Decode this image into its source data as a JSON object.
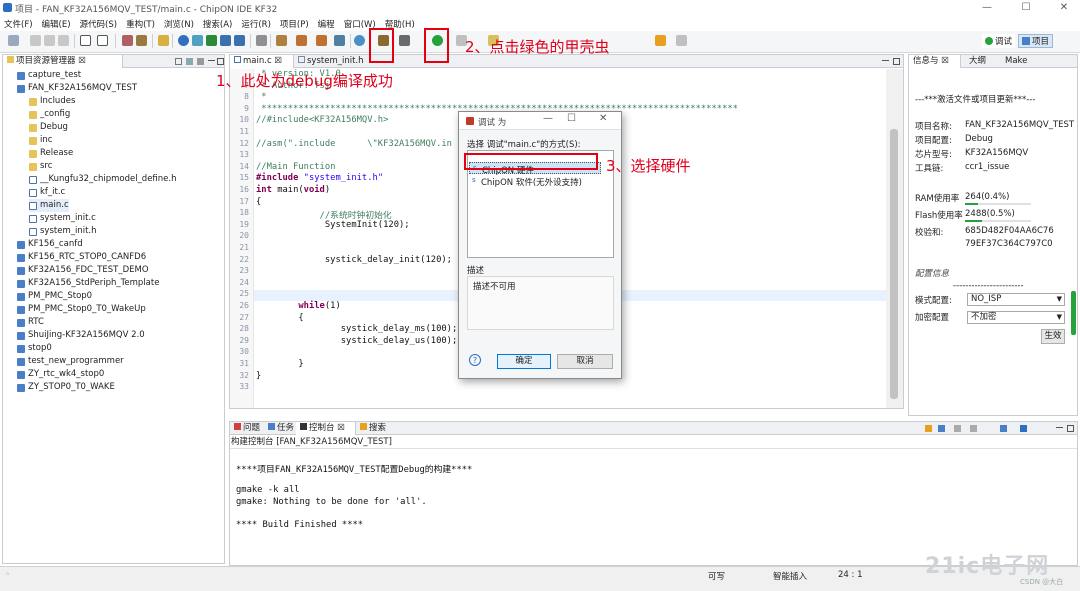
{
  "window": {
    "title": "项目 - FAN_KF32A156MQV_TEST/main.c - ChipON IDE KF32",
    "minimize": "—",
    "maximize": "☐",
    "close": "✕"
  },
  "menu": [
    "文件(F)",
    "编辑(E)",
    "源代码(S)",
    "重构(T)",
    "浏览(N)",
    "搜索(A)",
    "运行(R)",
    "项目(P)",
    "编程",
    "窗口(W)",
    "帮助(H)"
  ],
  "perspectives": {
    "debug": "调试",
    "project": "项目"
  },
  "project_explorer": {
    "title": "项目资源管理器 ☒",
    "items": [
      {
        "label": "capture_test",
        "type": "project",
        "level": 0
      },
      {
        "label": "FAN_KF32A156MQV_TEST",
        "type": "project",
        "level": 0
      },
      {
        "label": "Includes",
        "type": "folder",
        "level": 1
      },
      {
        "label": "_config",
        "type": "folder",
        "level": 1
      },
      {
        "label": "Debug",
        "type": "folder",
        "level": 1
      },
      {
        "label": "inc",
        "type": "folder",
        "level": 1
      },
      {
        "label": "Release",
        "type": "folder",
        "level": 1
      },
      {
        "label": "src",
        "type": "folder",
        "level": 1
      },
      {
        "label": "__Kungfu32_chipmodel_define.h",
        "type": "file",
        "level": 1
      },
      {
        "label": "kf_it.c",
        "type": "file",
        "level": 1
      },
      {
        "label": "main.c",
        "type": "file",
        "level": 1,
        "selected": true
      },
      {
        "label": "system_init.c",
        "type": "file",
        "level": 1
      },
      {
        "label": "system_init.h",
        "type": "file",
        "level": 1
      },
      {
        "label": "KF156_canfd",
        "type": "project",
        "level": 0
      },
      {
        "label": "KF156_RTC_STOP0_CANFD6",
        "type": "project",
        "level": 0
      },
      {
        "label": "KF32A156_FDC_TEST_DEMO",
        "type": "project",
        "level": 0
      },
      {
        "label": "KF32A156_StdPeriph_Template",
        "type": "project",
        "level": 0
      },
      {
        "label": "PM_PMC_Stop0",
        "type": "project",
        "level": 0
      },
      {
        "label": "PM_PMC_Stop0_T0_WakeUp",
        "type": "project",
        "level": 0
      },
      {
        "label": "RTC",
        "type": "project",
        "level": 0
      },
      {
        "label": "ShuiJing-KF32A156MQV 2.0",
        "type": "project",
        "level": 0
      },
      {
        "label": "stop0",
        "type": "project",
        "level": 0
      },
      {
        "label": "test_new_programmer",
        "type": "project",
        "level": 0
      },
      {
        "label": "ZY_rtc_wk4_stop0",
        "type": "project",
        "level": 0
      },
      {
        "label": "ZY_STOP0_T0_WAKE",
        "type": "project",
        "level": 0
      }
    ]
  },
  "editor": {
    "tabs": [
      "main.c ☒",
      "system_init.h"
    ],
    "lines": [
      {
        "n": "",
        "segs": [
          {
            "c": "cmt",
            "t": " * version: V1.0"
          }
        ]
      },
      {
        "n": "7",
        "segs": [
          {
            "c": "cmt",
            "t": " * Author: fsj"
          }
        ]
      },
      {
        "n": "8",
        "segs": [
          {
            "c": "cmt",
            "t": " *"
          }
        ]
      },
      {
        "n": "9",
        "segs": [
          {
            "c": "cmt",
            "t": " ******************************************************************************************"
          }
        ]
      },
      {
        "n": "10",
        "segs": [
          {
            "c": "cmt",
            "t": "//#include<KF32A156MQV.h>"
          }
        ]
      },
      {
        "n": "11",
        "segs": []
      },
      {
        "n": "12",
        "segs": [
          {
            "c": "cmt",
            "t": "//asm(\".include      \\\"KF32A156MQV.in"
          }
        ]
      },
      {
        "n": "13",
        "segs": []
      },
      {
        "n": "14",
        "segs": [
          {
            "c": "cmt",
            "t": "//Main Function"
          }
        ]
      },
      {
        "n": "15",
        "segs": [
          {
            "c": "kw",
            "t": "#include "
          },
          {
            "c": "str",
            "t": "\"system_init.h\""
          }
        ]
      },
      {
        "n": "16",
        "segs": [
          {
            "c": "kw",
            "t": "int "
          },
          {
            "c": "plain",
            "t": "main("
          },
          {
            "c": "kw",
            "t": "void"
          },
          {
            "c": "plain",
            "t": ")"
          }
        ]
      },
      {
        "n": "17",
        "segs": [
          {
            "c": "plain",
            "t": "{"
          }
        ]
      },
      {
        "n": "18",
        "segs": [
          {
            "c": "cmt",
            "t": "            //系统时钟初始化"
          }
        ]
      },
      {
        "n": "19",
        "segs": [
          {
            "c": "plain",
            "t": "             SystemInit(120);"
          }
        ]
      },
      {
        "n": "20",
        "segs": []
      },
      {
        "n": "21",
        "segs": []
      },
      {
        "n": "22",
        "segs": [
          {
            "c": "plain",
            "t": "             systick_delay_init(120);"
          }
        ]
      },
      {
        "n": "23",
        "segs": []
      },
      {
        "n": "24",
        "segs": []
      },
      {
        "n": "25",
        "segs": []
      },
      {
        "n": "26",
        "segs": [
          {
            "c": "kw",
            "t": "        while"
          },
          {
            "c": "plain",
            "t": "(1)"
          }
        ]
      },
      {
        "n": "27",
        "segs": [
          {
            "c": "plain",
            "t": "        {"
          }
        ]
      },
      {
        "n": "28",
        "segs": [
          {
            "c": "plain",
            "t": "                systick_delay_ms(100);"
          }
        ]
      },
      {
        "n": "29",
        "segs": [
          {
            "c": "plain",
            "t": "                systick_delay_us(100);"
          }
        ]
      },
      {
        "n": "30",
        "segs": []
      },
      {
        "n": "31",
        "segs": [
          {
            "c": "plain",
            "t": "        }"
          }
        ]
      },
      {
        "n": "32",
        "segs": [
          {
            "c": "plain",
            "t": "}"
          }
        ]
      },
      {
        "n": "33",
        "segs": []
      }
    ]
  },
  "dialog": {
    "title": "调试 为",
    "prompt": "选择 调试\"main.c\"的方式(S):",
    "options": [
      "ChipON 硬件",
      "ChipON 软件(无外设支持)"
    ],
    "desc_label": "描述",
    "desc_text": "描述不可用",
    "help": "?",
    "ok": "确定",
    "cancel": "取消"
  },
  "info_panel": {
    "tabs": [
      "信息与 ☒",
      "大纲",
      "Make"
    ],
    "notice": "---***激活文件或项目更新***---",
    "rows": [
      {
        "label": "项目名称:",
        "value": "FAN_KF32A156MQV_TEST"
      },
      {
        "label": "项目配置:",
        "value": "Debug"
      },
      {
        "label": "芯片型号:",
        "value": "KF32A156MQV"
      },
      {
        "label": "工具链:",
        "value": "ccr1_issue"
      }
    ],
    "ram_label": "RAM使用率",
    "ram_value": "264(0.4%)",
    "ram_fraction": 0.004,
    "flash_label": "Flash使用率",
    "flash_value": "2488(0.5%)",
    "flash_fraction": 0.005,
    "checksum_label": "校验和:",
    "checksum_1": "685D482F04AA6C76",
    "checksum_2": "79EF37C364C797C0",
    "config_title": "配置信息",
    "config_sep": "-----------------------",
    "mode_label": "模式配置:",
    "mode_value": "NO_ISP",
    "encrypt_label": "加密配置",
    "encrypt_value": "不加密",
    "apply": "生效"
  },
  "bottom": {
    "tabs": [
      "问题",
      "任务",
      "控制台 ☒",
      "搜索"
    ],
    "console_title": "构建控制台 [FAN_KF32A156MQV_TEST]",
    "lines": [
      "****项目FAN_KF32A156MQV_TEST配置Debug的构建****",
      "",
      "gmake -k all",
      "gmake: Nothing to be done for 'all'.",
      "",
      "**** Build Finished ****"
    ]
  },
  "status": {
    "writable": "可写",
    "insert": "智能插入",
    "position": "24 : 1"
  },
  "annotations": {
    "a1": "1、此处为debug编译成功",
    "a2": "2、点击绿色的甲壳虫",
    "a3": "3、选择硬件"
  },
  "watermark": {
    "brand": "21ic电子网",
    "sub": "CSDN @大白"
  }
}
